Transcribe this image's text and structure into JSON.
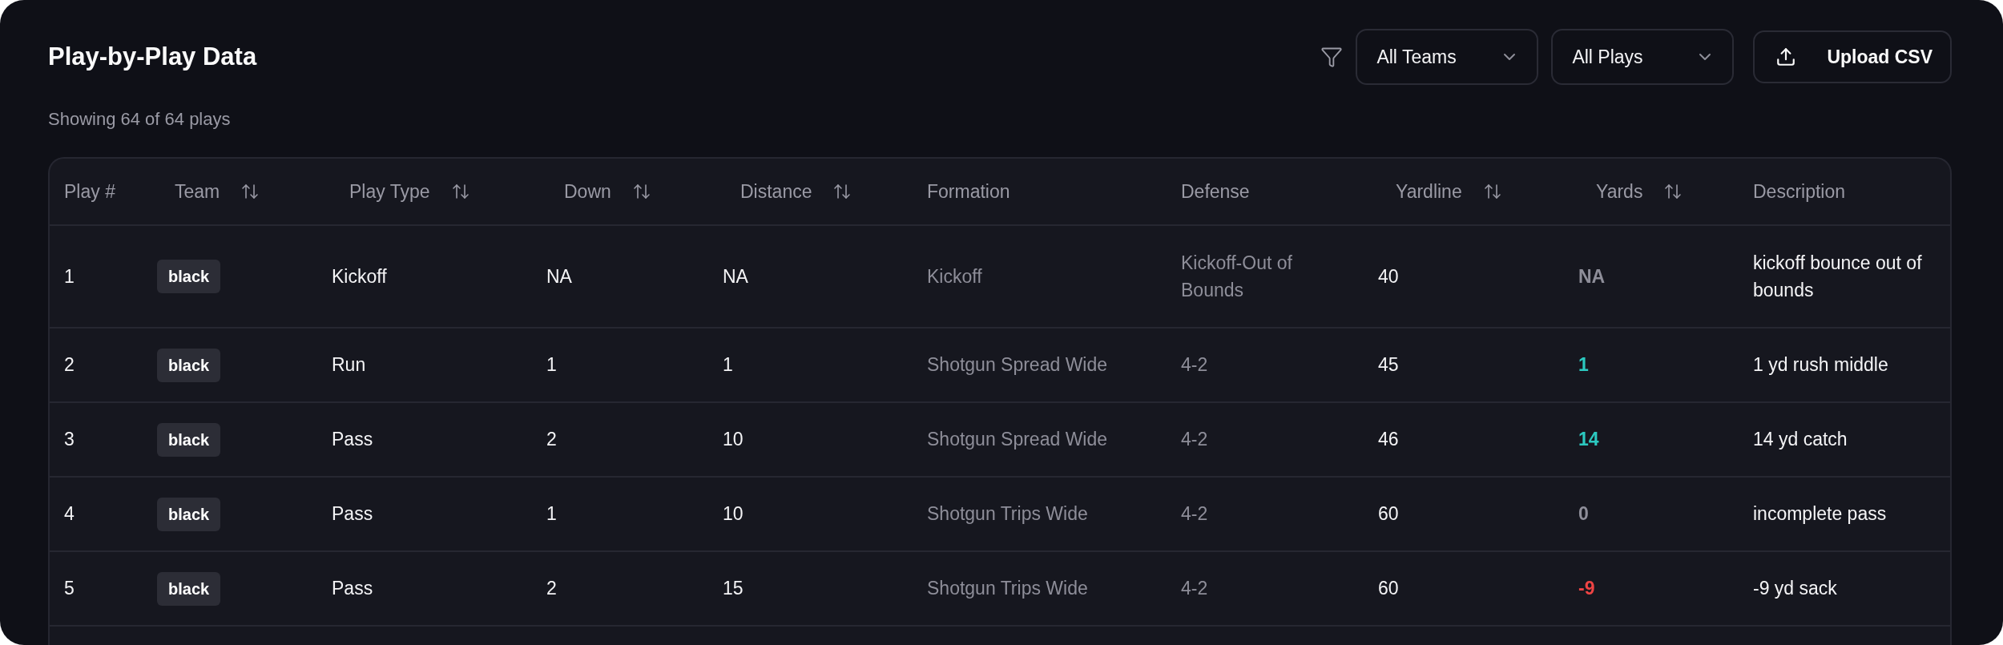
{
  "title": "Play-by-Play Data",
  "filters": [
    {
      "label": "All Teams"
    },
    {
      "label": "All Plays"
    }
  ],
  "upload_button": "Upload CSV",
  "summary": "Showing 64 of 64 plays",
  "table": {
    "columns": [
      {
        "label": "Play #",
        "sortable": false
      },
      {
        "label": "Team",
        "sortable": true
      },
      {
        "label": "Play Type",
        "sortable": true
      },
      {
        "label": "Down",
        "sortable": true
      },
      {
        "label": "Distance",
        "sortable": true
      },
      {
        "label": "Formation",
        "sortable": false
      },
      {
        "label": "Defense",
        "sortable": false
      },
      {
        "label": "Yardline",
        "sortable": true
      },
      {
        "label": "Yards",
        "sortable": true
      },
      {
        "label": "Description",
        "sortable": false
      }
    ],
    "rows": [
      {
        "play": "1",
        "team": "black",
        "play_type": "Kickoff",
        "down": "NA",
        "distance": "NA",
        "formation": "Kickoff",
        "defense": "Kickoff-Out of Bounds",
        "yardline": "40",
        "yards": {
          "value": "NA",
          "kind": "na"
        },
        "description": "kickoff bounce out of bounds"
      },
      {
        "play": "2",
        "team": "black",
        "play_type": "Run",
        "down": "1",
        "distance": "1",
        "formation": "Shotgun Spread Wide",
        "defense": "4-2",
        "yardline": "45",
        "yards": {
          "value": "1",
          "kind": "gain"
        },
        "description": "1 yd rush middle"
      },
      {
        "play": "3",
        "team": "black",
        "play_type": "Pass",
        "down": "2",
        "distance": "10",
        "formation": "Shotgun Spread Wide",
        "defense": "4-2",
        "yardline": "46",
        "yards": {
          "value": "14",
          "kind": "gain"
        },
        "description": "14 yd catch"
      },
      {
        "play": "4",
        "team": "black",
        "play_type": "Pass",
        "down": "1",
        "distance": "10",
        "formation": "Shotgun Trips Wide",
        "defense": "4-2",
        "yardline": "60",
        "yards": {
          "value": "0",
          "kind": "none"
        },
        "description": "incomplete pass"
      },
      {
        "play": "5",
        "team": "black",
        "play_type": "Pass",
        "down": "2",
        "distance": "15",
        "formation": "Shotgun Trips Wide",
        "defense": "4-2",
        "yardline": "60",
        "yards": {
          "value": "-9",
          "kind": "loss"
        },
        "description": "-9 yd sack"
      }
    ]
  }
}
